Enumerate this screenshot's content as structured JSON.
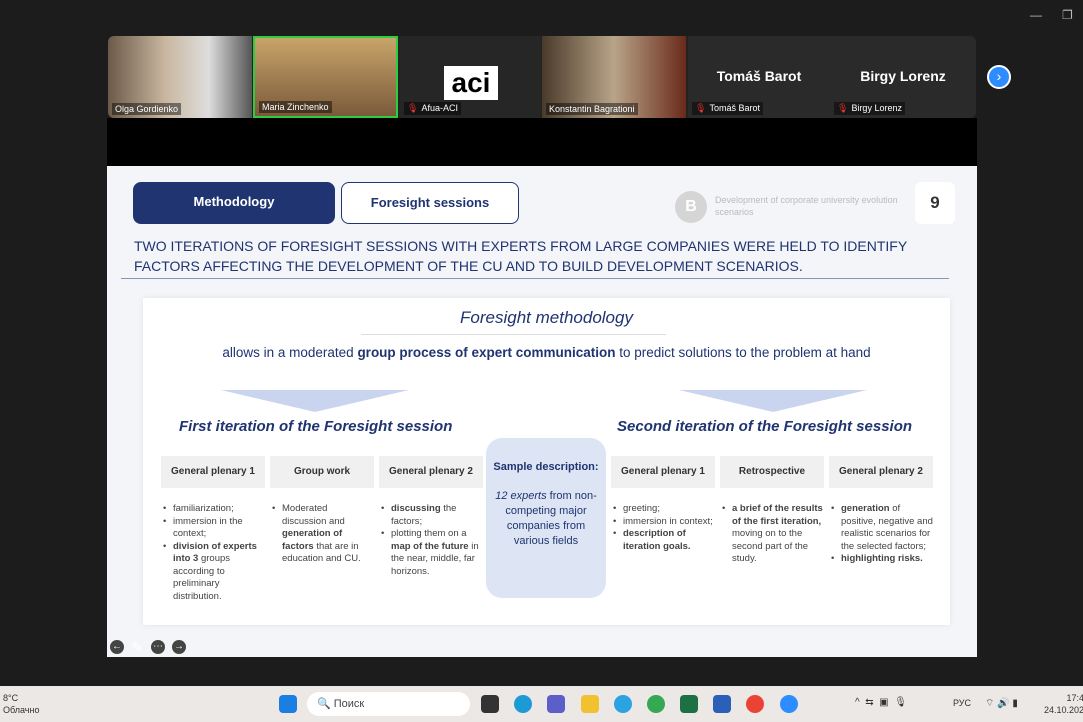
{
  "participants": [
    {
      "name": "Olga Gordienko",
      "muted": false
    },
    {
      "name": "Maria Zinchenko",
      "muted": false,
      "active": true
    },
    {
      "name": "Afua-ACI",
      "muted": true,
      "logo": "aci"
    },
    {
      "name": "Konstantin Bagrationi",
      "muted": false
    },
    {
      "name": "Tomáš Barot",
      "muted": true,
      "display": "Tomáš Barot"
    },
    {
      "name": "Birgy Lorenz",
      "muted": true,
      "display": "Birgy Lorenz"
    }
  ],
  "slide": {
    "tab_active": "Methodology",
    "tab_other": "Foresight sessions",
    "header_note": "Development of corporate university evolution scenarios",
    "page": "9",
    "heading": "TWO ITERATIONS OF FORESIGHT SESSIONS WITH EXPERTS FROM LARGE COMPANIES WERE HELD TO IDENTIFY FACTORS AFFECTING THE DEVELOPMENT OF THE CU AND TO BUILD DEVELOPMENT SCENARIOS.",
    "panel_title": "Foresight methodology",
    "allows_pre": "allows in a moderated ",
    "allows_bold": "group process of expert communication",
    "allows_post": " to predict solutions to the problem at hand",
    "first_title": "First iteration of the Foresight session",
    "second_title": "Second iteration of the Foresight session",
    "sample_title": "Sample description:",
    "sample_em": "12 experts",
    "sample_text": " from non-competing major companies from various fields",
    "columns": [
      {
        "title": "General plenary 1",
        "items": [
          "familiarization;",
          "immersion in the context;",
          "<b>division of experts into 3</b> groups according to preliminary distribution."
        ]
      },
      {
        "title": "Group work",
        "items": [
          "Moderated discussion and <b>generation of factors</b> that are in education and CU."
        ]
      },
      {
        "title": "General plenary 2",
        "items": [
          "<b>discussing</b> the factors;",
          "plotting them on a <b>map of the future</b> in the near, middle, far horizons."
        ]
      },
      {
        "title": "General plenary 1",
        "items": [
          "greeting;",
          "immersion in context;",
          "<b>description of iteration goals.</b>"
        ]
      },
      {
        "title": "Retrospective",
        "items": [
          "<b>a brief of the results of the first iteration,</b> moving on to the second part of the study."
        ]
      },
      {
        "title": "General plenary 2",
        "items": [
          "<b>generation</b> of positive, negative and realistic scenarios for the selected factors;",
          "<b>highlighting risks.</b>"
        ]
      }
    ]
  },
  "taskbar": {
    "weather_temp": "8°C",
    "weather_text": "Облачно",
    "search_placeholder": "Поиск",
    "lang": "РУС",
    "time": "17:4",
    "date": "24.10.202"
  },
  "colors": {
    "accent": "#1f3470",
    "active_speaker": "#2ecc40",
    "zoom_blue": "#2d8cff"
  }
}
